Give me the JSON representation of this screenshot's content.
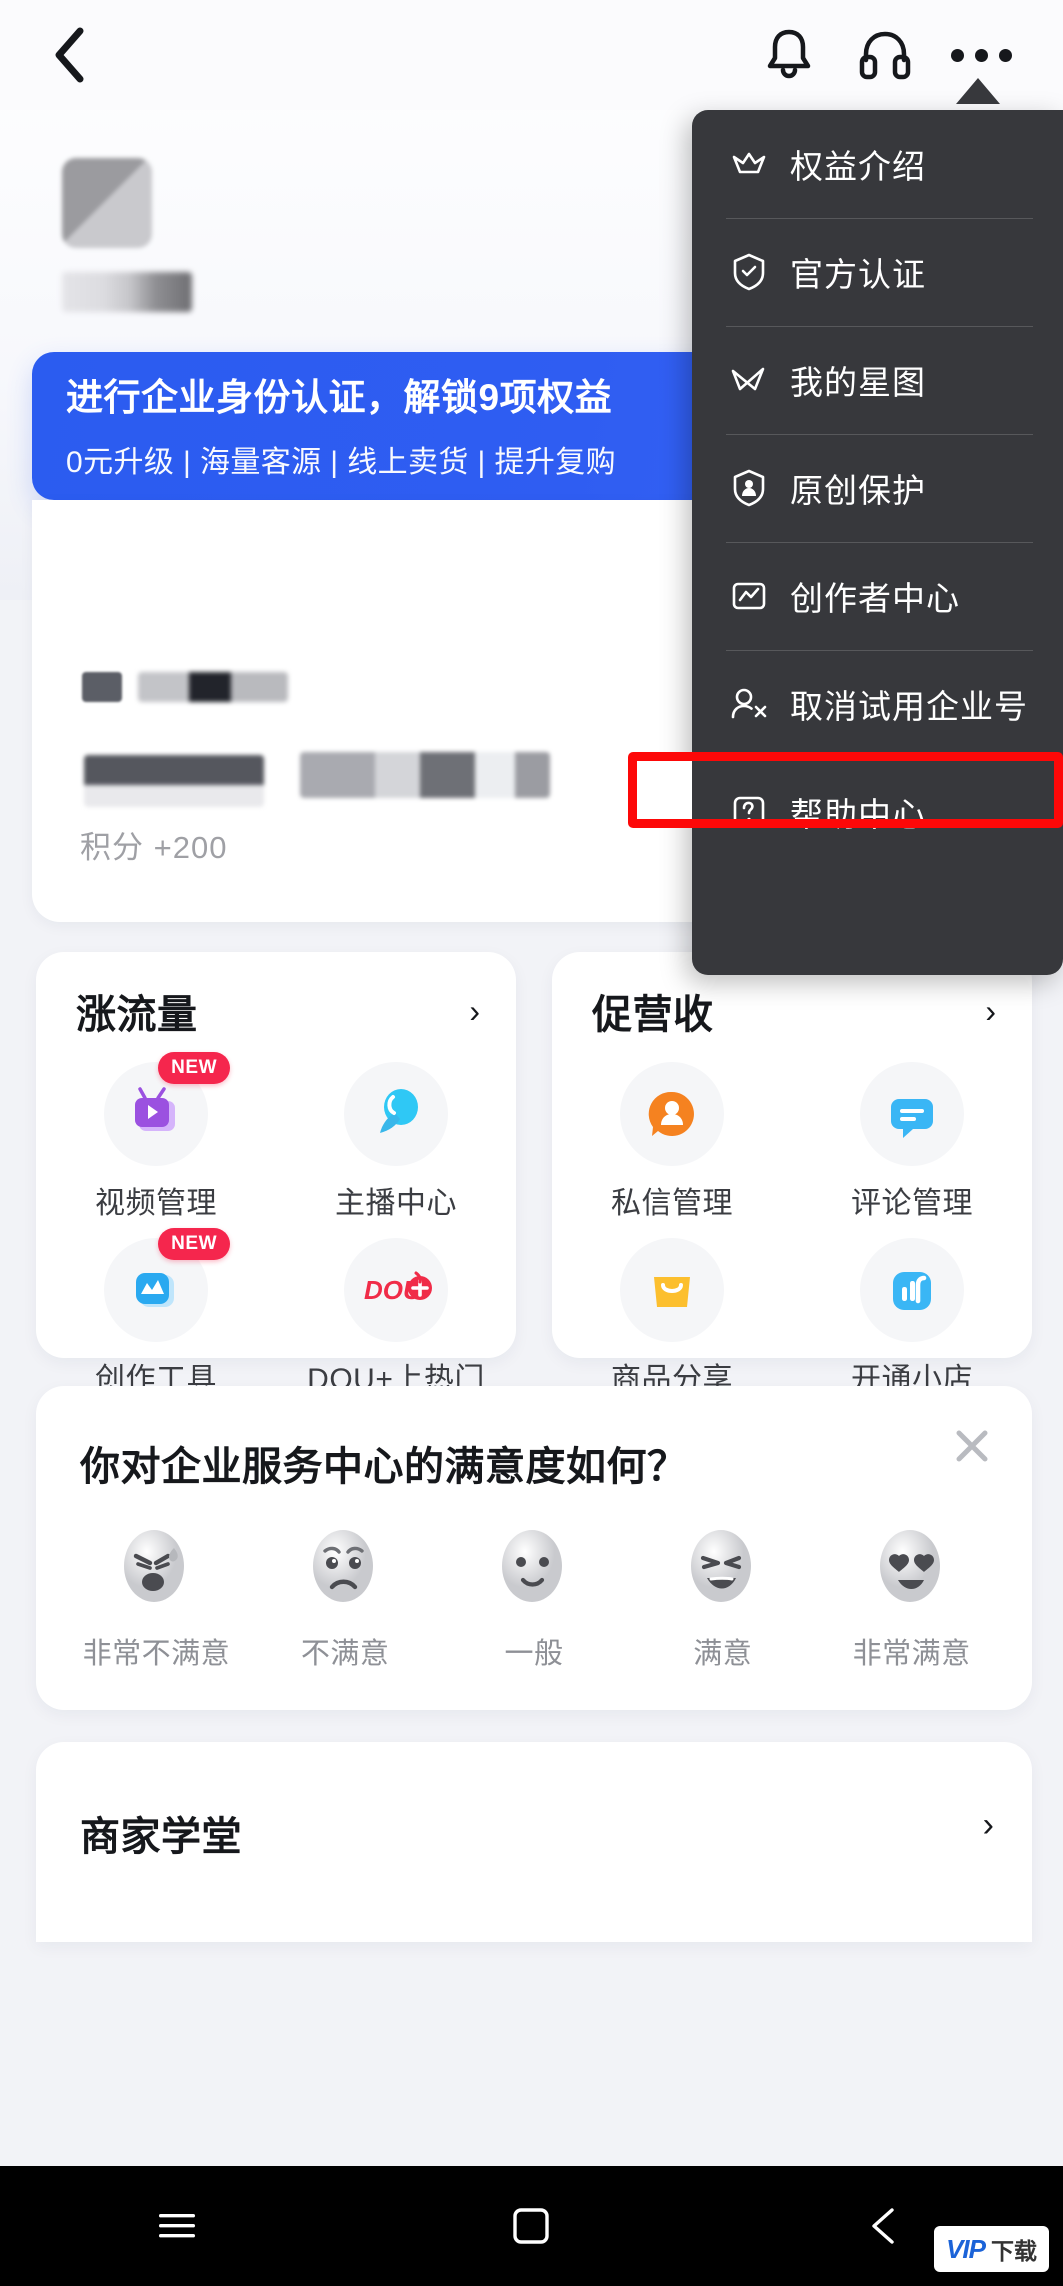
{
  "header": {
    "back_icon": "back-chevron-icon",
    "bell_icon": "bell-icon",
    "headset_icon": "headset-icon",
    "more_icon": "more-dots-icon"
  },
  "banner": {
    "title": "进行企业身份认证，解锁9项权益",
    "subtitle": "0元升级 | 海量客源 | 线上卖货 | 提升复购"
  },
  "points": {
    "label": "积分 +200"
  },
  "cards": [
    {
      "title": "涨流量",
      "chevron": "›",
      "tiles": [
        {
          "label": "视频管理",
          "badge": "NEW",
          "icon": "video-tv-icon"
        },
        {
          "label": "主播中心",
          "badge": "",
          "icon": "live-balloon-icon"
        },
        {
          "label": "创作工具",
          "badge": "NEW",
          "icon": "creation-tool-icon"
        },
        {
          "label": "DOU+上热门",
          "badge": "",
          "icon": "dou-plus-icon"
        }
      ]
    },
    {
      "title": "促营收",
      "chevron": "›",
      "tiles": [
        {
          "label": "私信管理",
          "badge": "",
          "icon": "private-message-icon"
        },
        {
          "label": "评论管理",
          "badge": "",
          "icon": "comment-icon"
        },
        {
          "label": "商品分享",
          "badge": "",
          "icon": "shopping-bag-icon"
        },
        {
          "label": "开通小店",
          "badge": "",
          "icon": "store-icon"
        }
      ]
    }
  ],
  "survey": {
    "question": "你对企业服务中心的满意度如何？",
    "close_icon": "close-icon",
    "options": [
      {
        "label": "非常不满意",
        "face": "very-angry-face"
      },
      {
        "label": "不满意",
        "face": "sad-face"
      },
      {
        "label": "一般",
        "face": "neutral-face"
      },
      {
        "label": "满意",
        "face": "happy-face"
      },
      {
        "label": "非常满意",
        "face": "heart-eyes-face"
      }
    ]
  },
  "school": {
    "title": "商家学堂",
    "chevron": "›"
  },
  "menu": {
    "items": [
      {
        "label": "权益介绍",
        "icon": "crown-icon"
      },
      {
        "label": "官方认证",
        "icon": "shield-check-icon"
      },
      {
        "label": "我的星图",
        "icon": "star-chart-icon"
      },
      {
        "label": "原创保护",
        "icon": "shield-person-icon"
      },
      {
        "label": "创作者中心",
        "icon": "chart-box-icon"
      },
      {
        "label": "取消试用企业号",
        "icon": "person-remove-icon",
        "highlighted": true
      },
      {
        "label": "帮助中心",
        "icon": "question-box-icon"
      }
    ],
    "highlight_color": "#fd0808",
    "background_color": "#37383c"
  },
  "navbar": {
    "menu_icon": "android-menu-icon",
    "home_icon": "android-home-icon",
    "back_icon": "android-back-icon"
  },
  "watermark": {
    "brand": "VIP",
    "text": "下载"
  },
  "colors": {
    "banner_blue": "#2b5cf0",
    "badge_red": "#f5264d",
    "menu_dark": "#37383c",
    "page_bg": "#f2f3f7"
  }
}
